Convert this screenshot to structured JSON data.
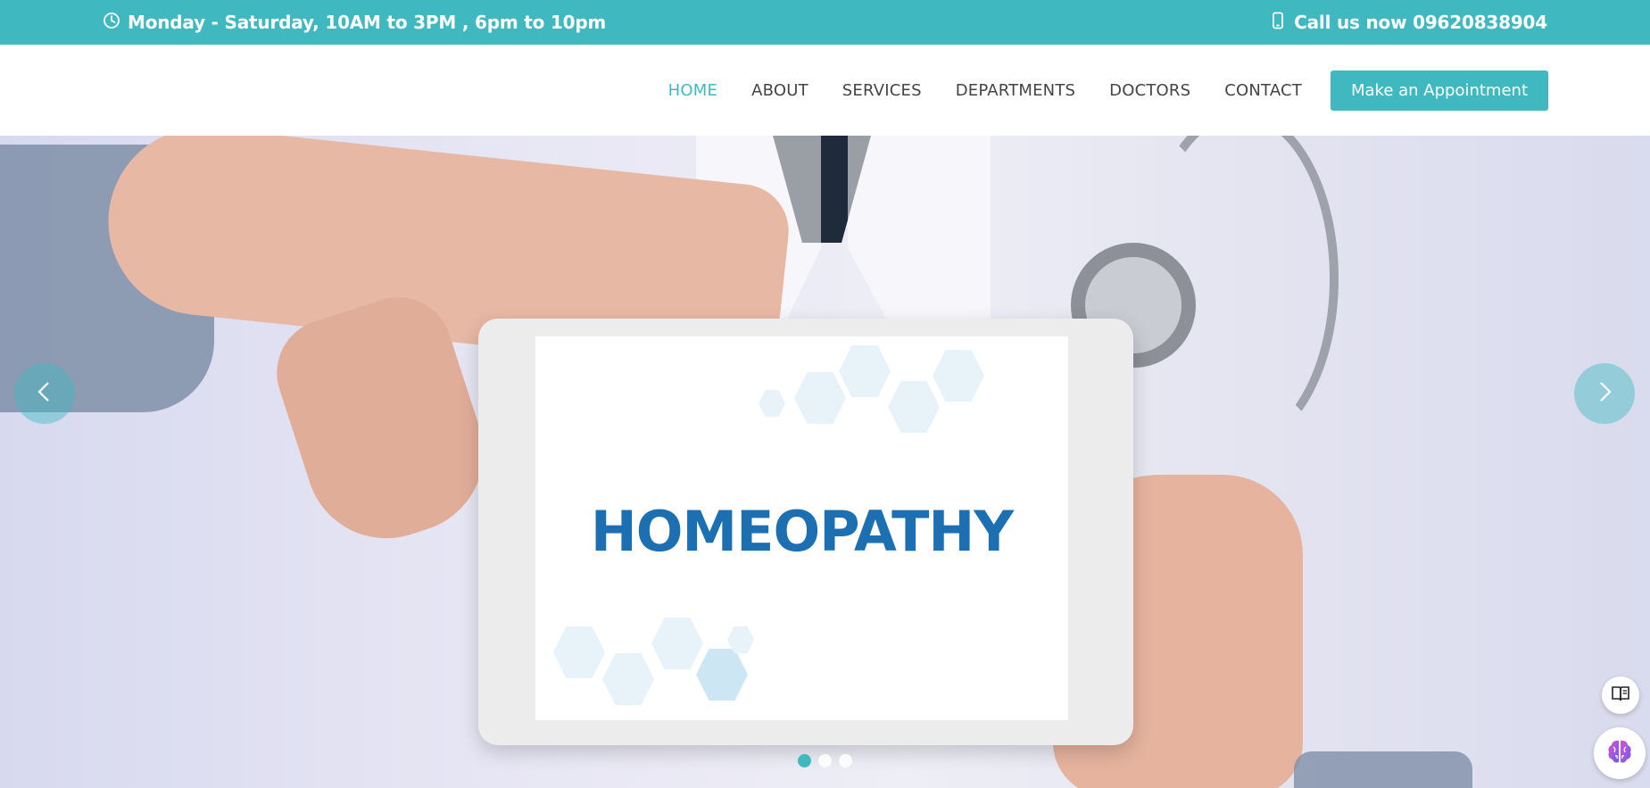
{
  "topbar": {
    "hours": "Monday - Saturday, 10AM to 3PM , 6pm to 10pm",
    "phone": "Call us now 09620838904",
    "clock_icon": "clock-icon",
    "phone_icon": "mobile-phone-icon"
  },
  "nav": {
    "items": [
      {
        "label": "HOME",
        "active": true
      },
      {
        "label": "ABOUT",
        "active": false
      },
      {
        "label": "SERVICES",
        "active": false
      },
      {
        "label": "DEPARTMENTS",
        "active": false
      },
      {
        "label": "DOCTORS",
        "active": false
      },
      {
        "label": "CONTACT",
        "active": false
      }
    ],
    "cta_label": "Make an Appointment"
  },
  "hero": {
    "screen_text": "HOMEOPATHY",
    "prev_icon": "chevron-left-icon",
    "next_icon": "chevron-right-icon",
    "slides": 3,
    "active_slide": 1
  },
  "widgets": {
    "reader_icon": "reader-book-icon",
    "assistant_icon": "brain-icon"
  },
  "colors": {
    "accent": "#3fb9bf",
    "headline": "#1c6fb1",
    "nav_text": "#444444"
  }
}
